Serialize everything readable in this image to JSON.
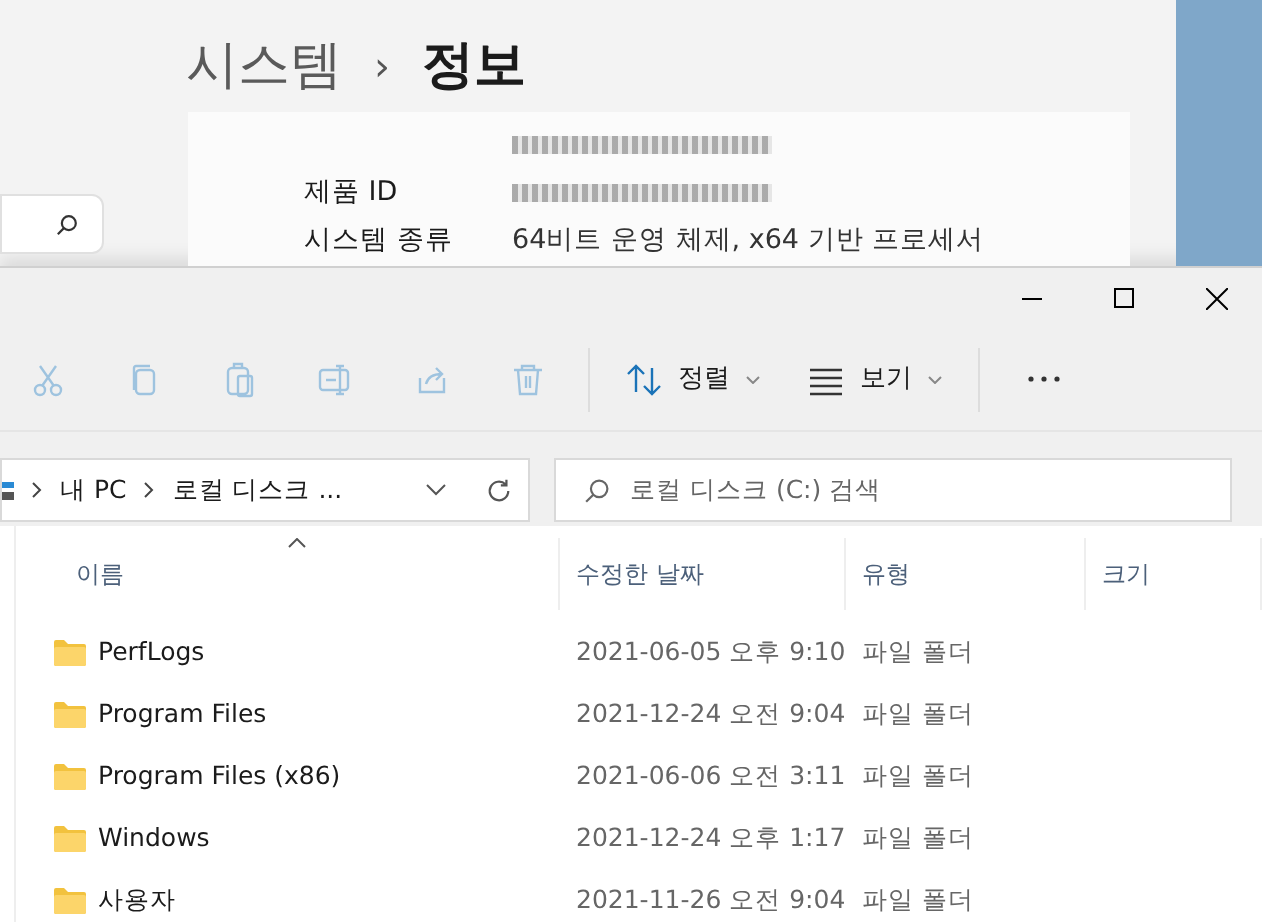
{
  "settings": {
    "breadcrumb": [
      "시스템",
      "정보"
    ],
    "separator": "›",
    "rows": [
      {
        "label": "",
        "value_redacted": true
      },
      {
        "label": "제품 ID",
        "value_redacted": true
      },
      {
        "label": "시스템 종류",
        "value": "64비트 운영 체제, x64 기반 프로세서"
      }
    ]
  },
  "explorer": {
    "toolbar": [
      {
        "kind": "icon",
        "disabled": true
      },
      {
        "kind": "icon",
        "disabled": true
      },
      {
        "kind": "icon",
        "disabled": true
      },
      {
        "kind": "icon",
        "disabled": true
      },
      {
        "kind": "icon",
        "disabled": true
      },
      {
        "kind": "icon",
        "disabled": true
      },
      {
        "kind": "separator"
      },
      {
        "kind": "menu",
        "label": "정렬",
        "disabled": false
      },
      {
        "kind": "menu",
        "label": "보기",
        "disabled": false
      },
      {
        "kind": "separator"
      },
      {
        "kind": "more",
        "disabled": false
      }
    ],
    "address": [
      "내 PC",
      "로컬 디스크 ..."
    ],
    "search": {
      "placeholder": "로컬 디스크 (C:) 검색"
    },
    "columns": [
      {
        "label": "이름",
        "sorted": true
      },
      {
        "label": "수정한 날짜",
        "sorted": false
      },
      {
        "label": "유형",
        "sorted": false
      },
      {
        "label": "크기",
        "sorted": false
      }
    ],
    "rows": [
      {
        "name": "PerfLogs",
        "date": "2021-06-05 오후 9:10",
        "type": "파일 폴더"
      },
      {
        "name": "Program Files",
        "date": "2021-12-24 오전 9:04",
        "type": "파일 폴더"
      },
      {
        "name": "Program Files (x86)",
        "date": "2021-06-06 오전 3:11",
        "type": "파일 폴더"
      },
      {
        "name": "Windows",
        "date": "2021-12-24 오후 1:17",
        "type": "파일 폴더"
      },
      {
        "name": "사용자",
        "date": "2021-11-26 오전 9:04",
        "type": "파일 폴더"
      }
    ]
  }
}
